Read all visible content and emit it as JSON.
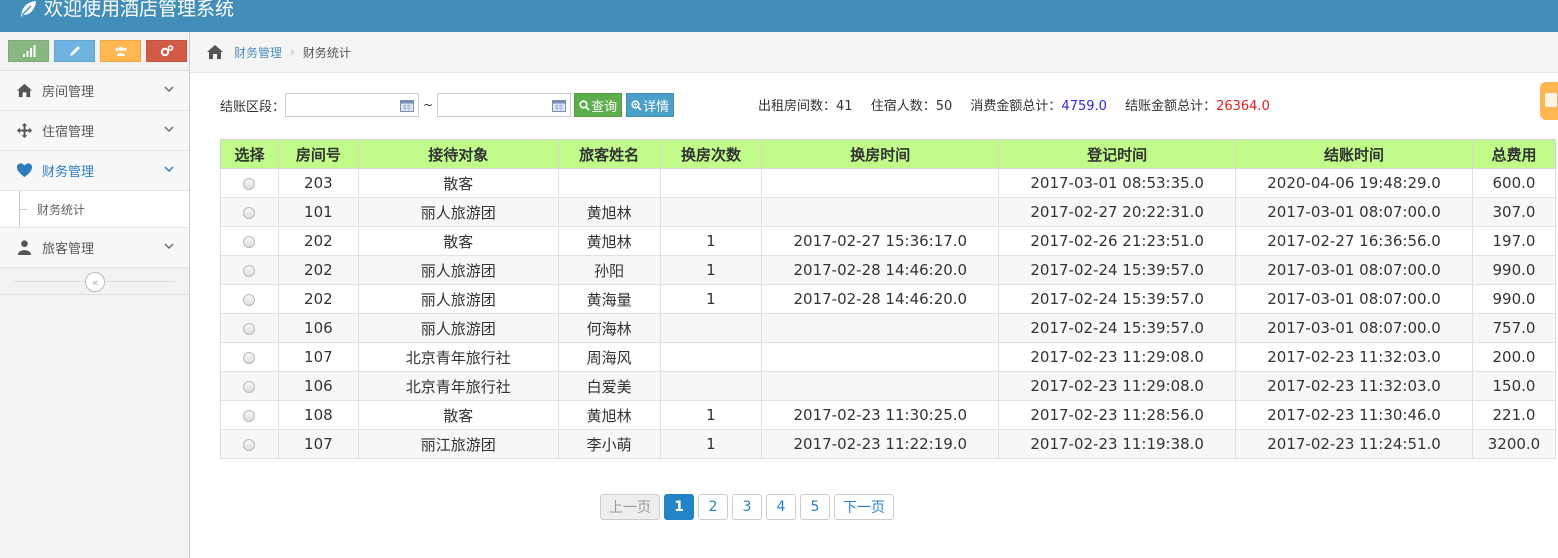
{
  "app": {
    "title": "欢迎使用酒店管理系统"
  },
  "shortcuts": [
    {
      "name": "signal-icon",
      "color": "#87b87f"
    },
    {
      "name": "pencil-icon",
      "color": "#6fb3e0"
    },
    {
      "name": "users-icon",
      "color": "#ffb752"
    },
    {
      "name": "cogs-icon",
      "color": "#d15b47"
    }
  ],
  "sidebar": {
    "items": [
      {
        "label": "房间管理",
        "icon": "home-icon"
      },
      {
        "label": "住宿管理",
        "icon": "arrows-move-icon"
      },
      {
        "label": "财务管理",
        "icon": "heart-icon",
        "active": true,
        "sub": [
          {
            "label": "财务统计"
          }
        ]
      },
      {
        "label": "旅客管理",
        "icon": "user-icon"
      }
    ],
    "collapse": "«"
  },
  "breadcrumb": {
    "parent": "财务管理",
    "current": "财务统计"
  },
  "filter": {
    "label": "结账区段：",
    "start_value": "",
    "end_value": "",
    "separator": "~",
    "query_label": "查询",
    "detail_label": "详情"
  },
  "stats": {
    "rooms_label": "出租房间数：",
    "rooms_value": "41",
    "guests_label": "住宿人数：",
    "guests_value": "50",
    "consume_label": "消费金额总计：",
    "consume_value": "4759.0",
    "checkout_label": "结账金额总计：",
    "checkout_value": "26364.0"
  },
  "table": {
    "headers": [
      "选择",
      "房间号",
      "接待对象",
      "旅客姓名",
      "换房次数",
      "换房时间",
      "登记时间",
      "结账时间",
      "总费用"
    ],
    "rows": [
      [
        "203",
        "散客",
        "",
        "",
        "",
        "2017-03-01 08:53:35.0",
        "2020-04-06 19:48:29.0",
        "600.0"
      ],
      [
        "101",
        "丽人旅游团",
        "黄旭林",
        "",
        "",
        "2017-02-27 20:22:31.0",
        "2017-03-01 08:07:00.0",
        "307.0"
      ],
      [
        "202",
        "散客",
        "黄旭林",
        "1",
        "2017-02-27 15:36:17.0",
        "2017-02-26 21:23:51.0",
        "2017-02-27 16:36:56.0",
        "197.0"
      ],
      [
        "202",
        "丽人旅游团",
        "孙阳",
        "1",
        "2017-02-28 14:46:20.0",
        "2017-02-24 15:39:57.0",
        "2017-03-01 08:07:00.0",
        "990.0"
      ],
      [
        "202",
        "丽人旅游团",
        "黄海量",
        "1",
        "2017-02-28 14:46:20.0",
        "2017-02-24 15:39:57.0",
        "2017-03-01 08:07:00.0",
        "990.0"
      ],
      [
        "106",
        "丽人旅游团",
        "何海林",
        "",
        "",
        "2017-02-24 15:39:57.0",
        "2017-03-01 08:07:00.0",
        "757.0"
      ],
      [
        "107",
        "北京青年旅行社",
        "周海风",
        "",
        "",
        "2017-02-23 11:29:08.0",
        "2017-02-23 11:32:03.0",
        "200.0"
      ],
      [
        "106",
        "北京青年旅行社",
        "白爱美",
        "",
        "",
        "2017-02-23 11:29:08.0",
        "2017-02-23 11:32:03.0",
        "150.0"
      ],
      [
        "108",
        "散客",
        "黄旭林",
        "1",
        "2017-02-23 11:30:25.0",
        "2017-02-23 11:28:56.0",
        "2017-02-23 11:30:46.0",
        "221.0"
      ],
      [
        "107",
        "丽江旅游团",
        "李小萌",
        "1",
        "2017-02-23 11:22:19.0",
        "2017-02-23 11:19:38.0",
        "2017-02-23 11:24:51.0",
        "3200.0"
      ]
    ]
  },
  "pagination": {
    "prev": "上一页",
    "pages": [
      "1",
      "2",
      "3",
      "4",
      "5"
    ],
    "current": "1",
    "next": "下一页"
  }
}
